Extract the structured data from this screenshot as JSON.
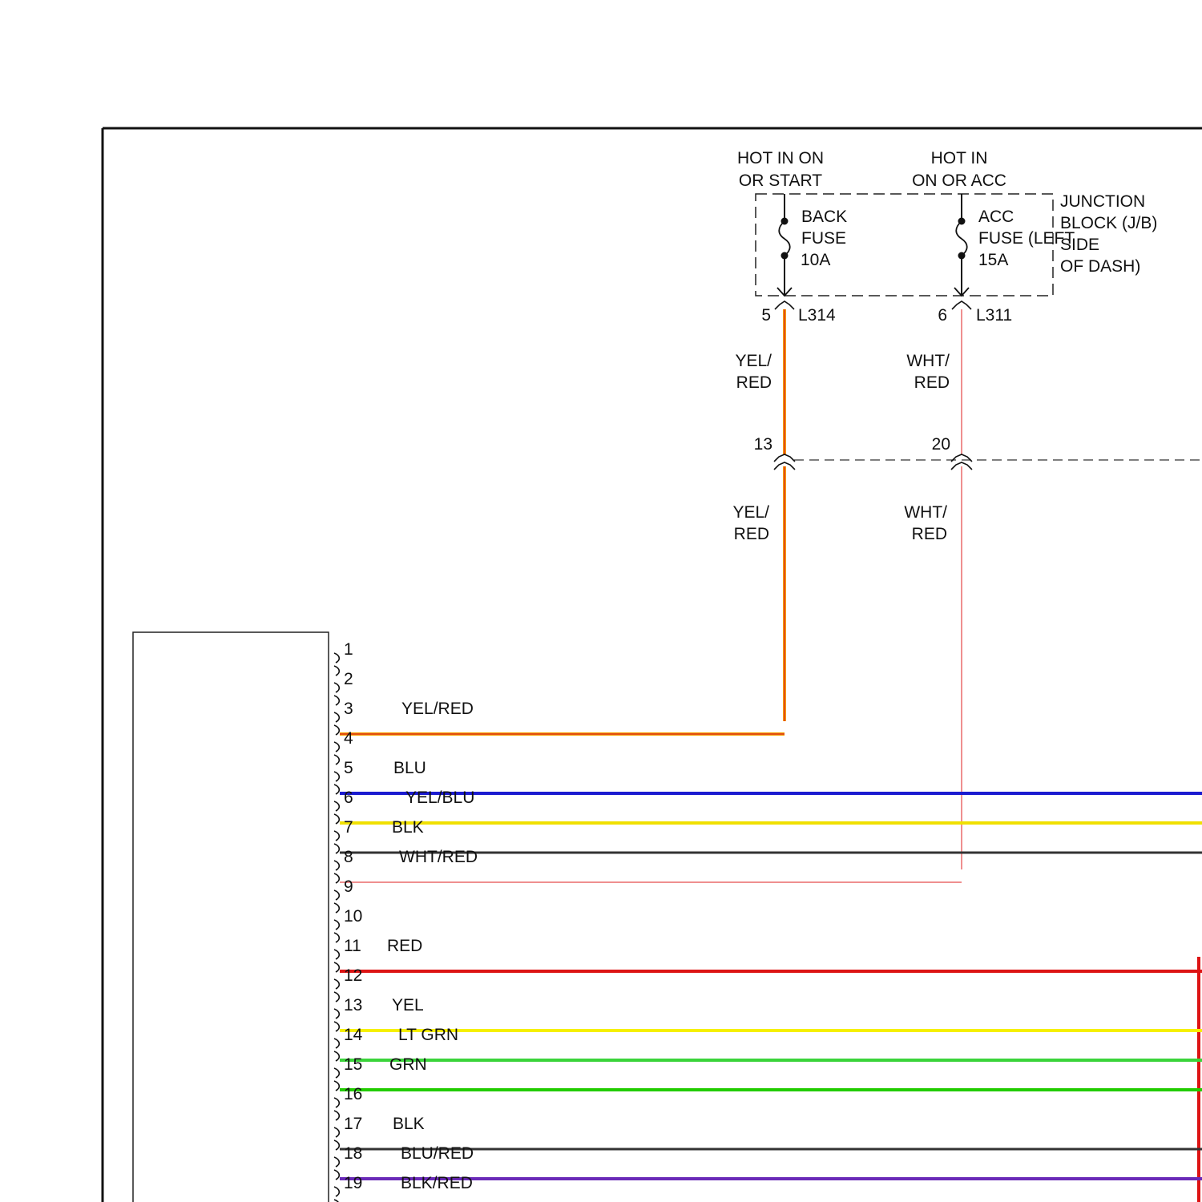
{
  "power_sources": {
    "hot_start": [
      "HOT IN ON",
      "OR START"
    ],
    "hot_acc": [
      "HOT IN",
      "ON OR ACC"
    ]
  },
  "junction_block": {
    "label": [
      "JUNCTION",
      "BLOCK (J/B)",
      "SIDE",
      "OF DASH)"
    ],
    "fuses": {
      "back": [
        "BACK",
        "FUSE",
        "10A"
      ],
      "acc": [
        "ACC",
        "FUSE (LEFT",
        "15A"
      ]
    }
  },
  "jb_connectors": {
    "left_pin": "5",
    "left_code": "L314",
    "right_pin": "6",
    "right_code": "L311"
  },
  "inline_connector": {
    "left_pin": "13",
    "right_pin": "20"
  },
  "riser_labels": {
    "left_upper": [
      "YEL/",
      "RED"
    ],
    "right_upper": [
      "WHT/",
      "RED"
    ],
    "left_lower": [
      "YEL/",
      "RED"
    ],
    "right_lower": [
      "WHT/",
      "RED"
    ]
  },
  "colors": {
    "YEL/RED": "#f5a000",
    "YEL/RED_tracer": "#d81e1e",
    "BLU": "#1a1ad0",
    "YEL/BLU": "#f0e000",
    "BLK": "#333333",
    "WHT/RED": "#ef8f8f",
    "RED": "#dd1414",
    "YEL": "#f6f000",
    "LT GRN": "#3ad43a",
    "GRN": "#22cc00",
    "BLU/RED": "#6a2ab8",
    "BLK/RED": "#9a2020"
  },
  "pins": [
    {
      "num": "1",
      "wire": ""
    },
    {
      "num": "2",
      "wire": ""
    },
    {
      "num": "3",
      "wire": "YEL/RED"
    },
    {
      "num": "4",
      "wire": ""
    },
    {
      "num": "5",
      "wire": "BLU"
    },
    {
      "num": "6",
      "wire": "YEL/BLU"
    },
    {
      "num": "7",
      "wire": "BLK"
    },
    {
      "num": "8",
      "wire": "WHT/RED"
    },
    {
      "num": "9",
      "wire": ""
    },
    {
      "num": "10",
      "wire": ""
    },
    {
      "num": "11",
      "wire": "RED"
    },
    {
      "num": "12",
      "wire": ""
    },
    {
      "num": "13",
      "wire": "YEL"
    },
    {
      "num": "14",
      "wire": "LT GRN"
    },
    {
      "num": "15",
      "wire": "GRN"
    },
    {
      "num": "16",
      "wire": ""
    },
    {
      "num": "17",
      "wire": "BLK"
    },
    {
      "num": "18",
      "wire": "BLU/RED"
    },
    {
      "num": "19",
      "wire": "BLK/RED"
    }
  ]
}
